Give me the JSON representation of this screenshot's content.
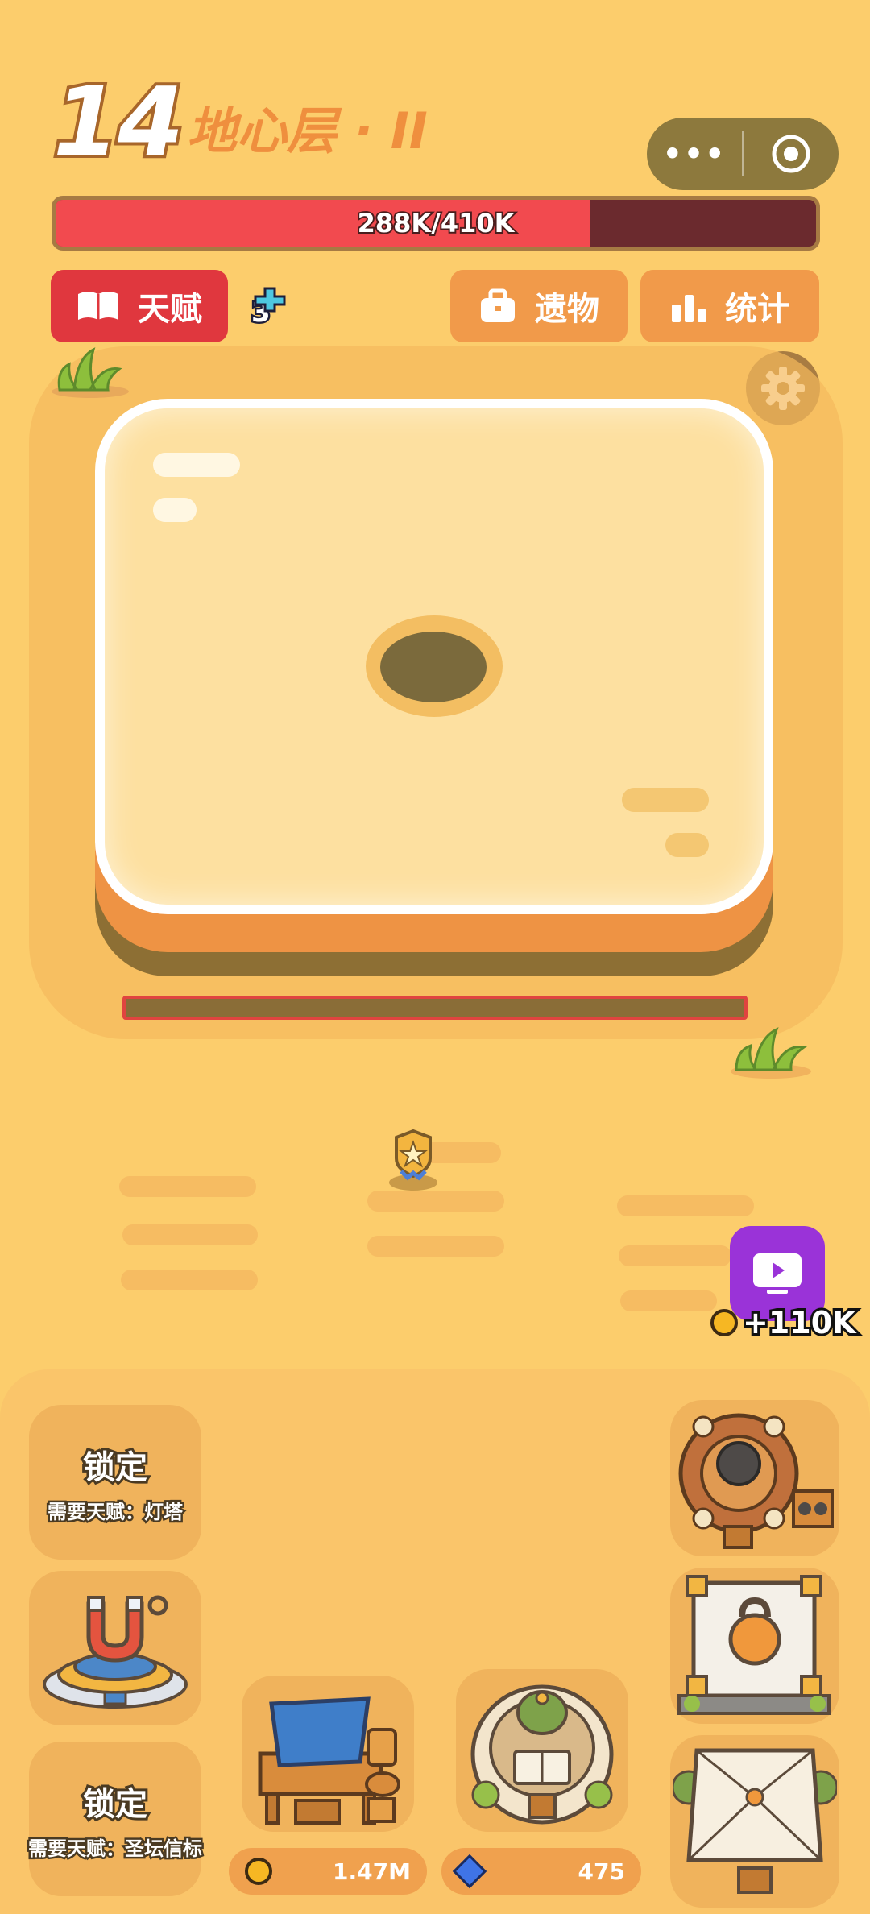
{
  "header": {
    "level_number": "14",
    "level_name": "地心层 · II"
  },
  "capsule": {
    "menu_icon": "more-dots-icon",
    "close_icon": "target-icon"
  },
  "hp": {
    "current": 288,
    "max": 410,
    "text": "288K/410K",
    "fill_fraction": 0.702,
    "fill_color": "#f24a4f"
  },
  "buttons": {
    "talent": "天赋",
    "relic": "遗物",
    "stats": "统计"
  },
  "talent_points": "3",
  "ad_reward": {
    "amount": "+110K"
  },
  "slots": {
    "locked_1": {
      "title": "锁定",
      "requirement": "需要天赋：灯塔"
    },
    "locked_2": {
      "title": "锁定",
      "requirement": "需要天赋：圣坛信标"
    }
  },
  "currencies": {
    "coins": "1.47M",
    "gems": "475"
  }
}
